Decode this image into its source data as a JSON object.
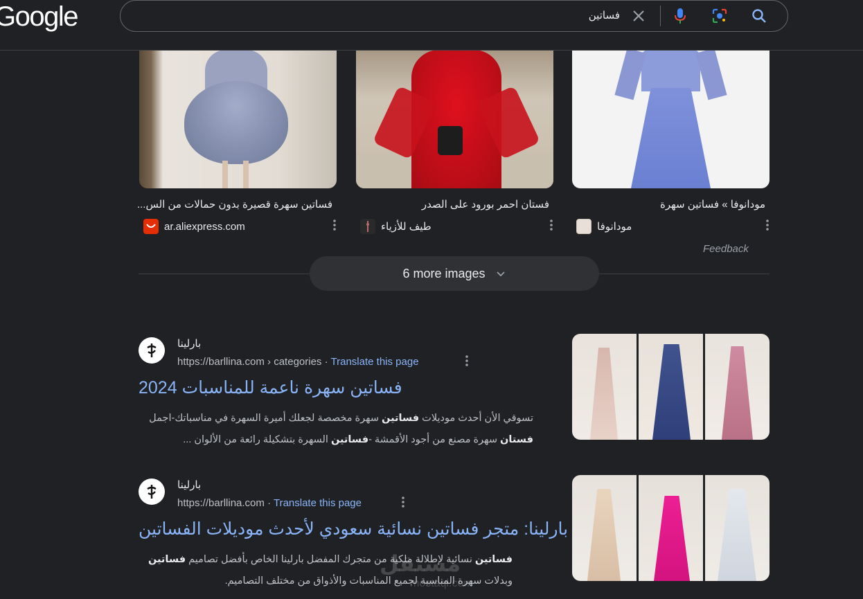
{
  "header": {
    "logo": "Google",
    "search_query": "فساتين"
  },
  "images": [
    {
      "title": "فساتين سهرة قصيرة بدون حمالات من الس...",
      "source": "ar.aliexpress.com",
      "favicon": "aliexpress-favicon",
      "colors": [
        "#e6e1da",
        "#8d96b3",
        "#6f5e4c"
      ]
    },
    {
      "title": "فستان احمر بورود على الصدر",
      "source": "طيف للأزياء",
      "favicon": "taif-favicon",
      "colors": [
        "#cfc8bc",
        "#c4131c",
        "#2b2b2b"
      ]
    },
    {
      "title": "مودانوفا » فساتين سهرة",
      "source": "مودانوفا",
      "favicon": "modanova-favicon",
      "colors": [
        "#f2f2f2",
        "#7a8fd9",
        "#b9a6c9"
      ]
    }
  ],
  "feedback": "Feedback",
  "more_images": "6 more images",
  "results": [
    {
      "site_name": "بارلينا",
      "url": "https://barllina.com › categories",
      "translate": "Translate this page",
      "title": "فساتين سهرة ناعمة للمناسبات 2024",
      "snippet_line1": "تسوقي الأن أحدث موديلات <b>فساتين</b> سهرة مخصصة لجعلك أميرة السهرة في مناسباتك-اجمل",
      "snippet_line2": "<b>فستان</b> سهرة مصنع من أجود الأقمشة -<b>فساتين</b> السهرة بتشكيلة رائعة من الألوان ...",
      "thumb_colors": [
        "#d9b9b0",
        "#3c4f8f",
        "#c9869b"
      ]
    },
    {
      "site_name": "بارلينا",
      "url": "https://barllina.com",
      "translate": "Translate this page",
      "title": "بارلينا: متجر فساتين نسائية سعودي لأحدث موديلات الفساتين",
      "snippet_line1": "<b>فساتين</b> نسائية لإطلالة ملكية من متجرك المفضل بارلينا الخاص بأفضل تصاميم <b>فساتين</b>",
      "snippet_line2": "وبدلات سهرة المناسبة لجميع المناسبات والأذواق من مختلف التصاميم.",
      "thumb_colors": [
        "#e2cbb4",
        "#e0198b",
        "#d6dbe3"
      ]
    }
  ],
  "watermark": "مستقل",
  "watermark_sub": "mostaql.com"
}
